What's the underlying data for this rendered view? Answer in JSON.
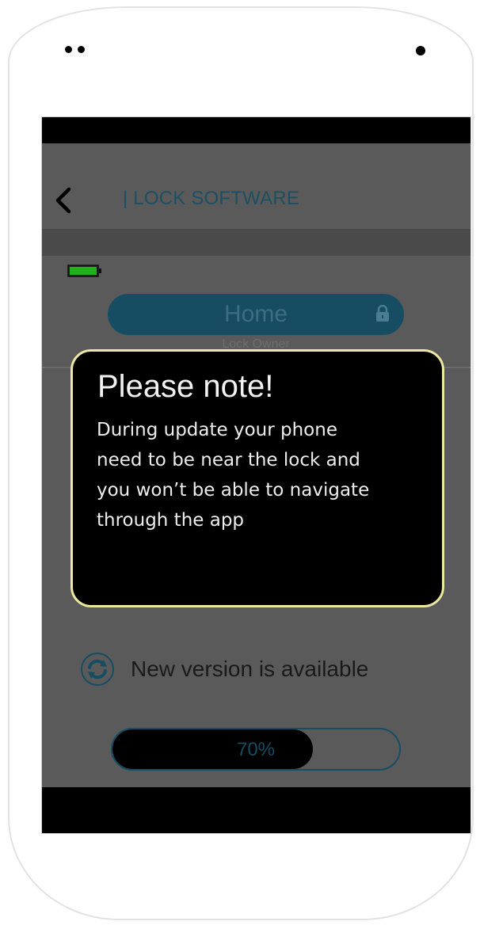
{
  "header": {
    "title": "| LOCK SOFTWARE",
    "back_icon": "chevron-left-icon"
  },
  "lock": {
    "name": "Home",
    "role": "Lock Owner",
    "lock_icon": "padlock-icon",
    "battery_icon": "battery-icon",
    "battery_color": "#1db31d"
  },
  "dialog": {
    "title": "Please note!",
    "lines": [
      "During update your phone",
      "need to be near the lock and",
      "you won’t be able to navigate",
      "through the app"
    ]
  },
  "update": {
    "icon": "refresh-icon",
    "status_text": "New version is available"
  },
  "progress": {
    "value": 0.7,
    "label": "70%"
  },
  "colors": {
    "accent": "#164d63",
    "overlay_background": "#5a5a5a",
    "dialog_border": "#ece8a0"
  }
}
